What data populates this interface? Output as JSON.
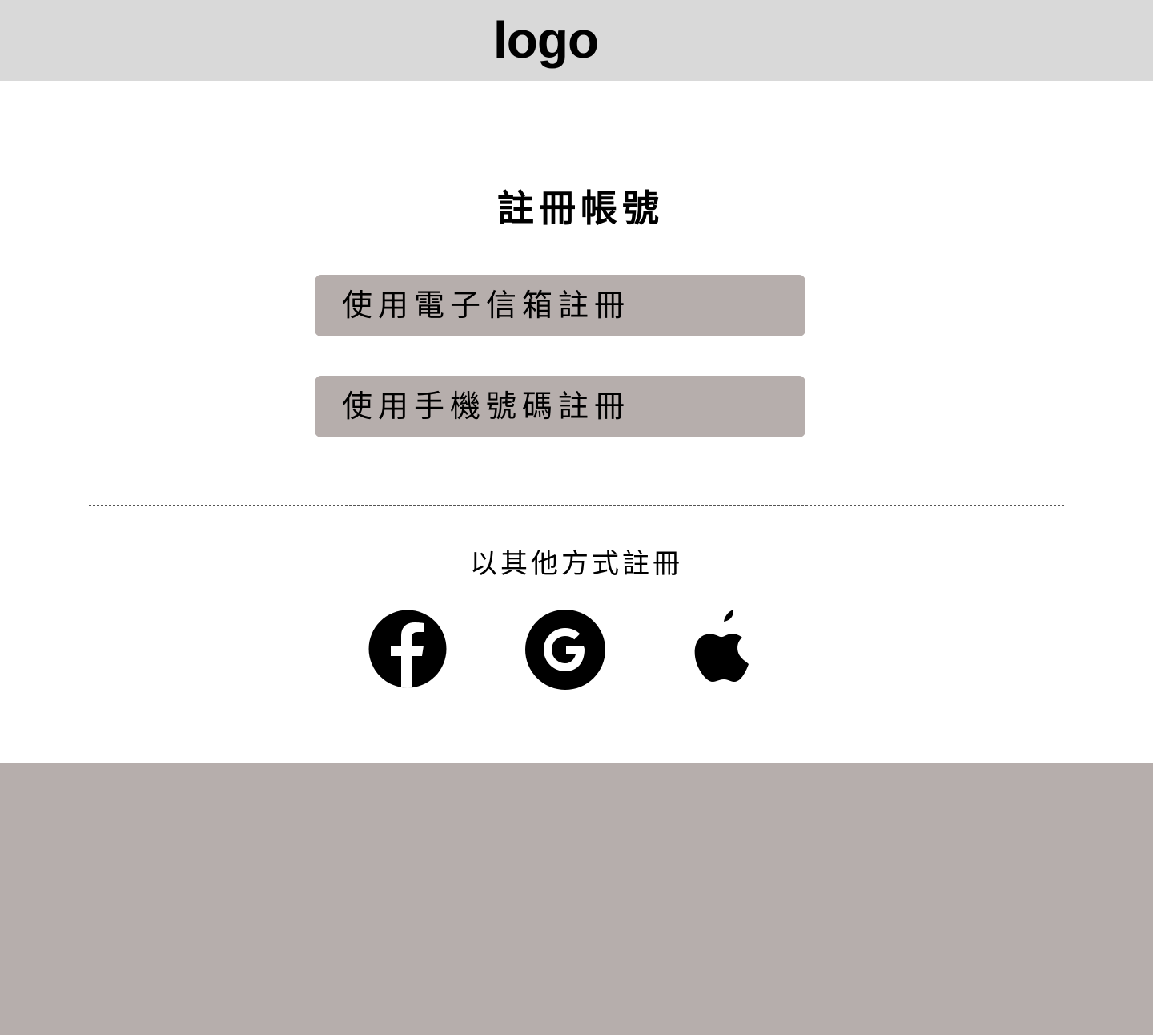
{
  "header": {
    "logo_text": "logo"
  },
  "main": {
    "title": "註冊帳號",
    "email_register_label": "使用電子信箱註冊",
    "phone_register_label": "使用手機號碼註冊",
    "other_methods_title": "以其他方式註冊"
  },
  "social": [
    {
      "icon": "facebook-icon"
    },
    {
      "icon": "google-icon"
    },
    {
      "icon": "apple-icon"
    }
  ],
  "colors": {
    "header_bg": "#d9d9d9",
    "button_bg": "#b6aeac",
    "footer_bg": "#b6aeac",
    "text": "#000000"
  }
}
